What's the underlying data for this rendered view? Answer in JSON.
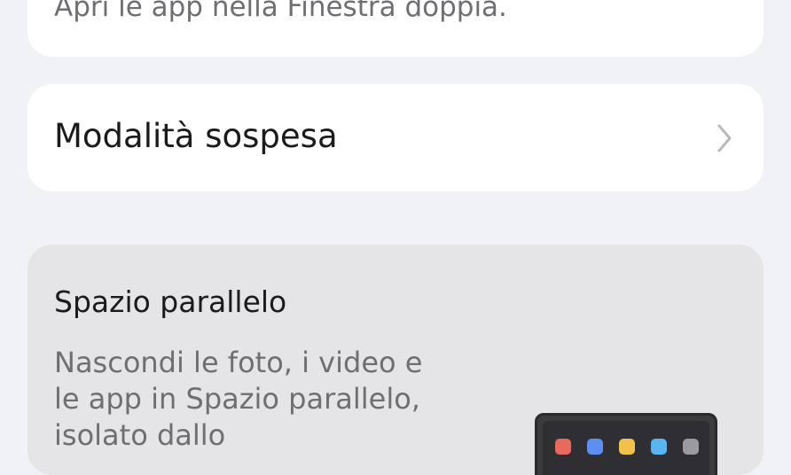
{
  "dual_window_card": {
    "subtitle": "Apri le app nella Finestra doppia."
  },
  "suspended_mode_card": {
    "label": "Modalità sospesa",
    "icon": "chevron-right-icon"
  },
  "parallel_space_card": {
    "title": "Spazio parallelo",
    "description": "Nascondi le foto, i video e le app in Spazio parallelo, isolato dallo"
  },
  "illustration": {
    "app_icon_colors": [
      "#e86a5a",
      "#5b8ff0",
      "#f0c24a",
      "#5ab4f0",
      "#9a9aa0"
    ]
  }
}
